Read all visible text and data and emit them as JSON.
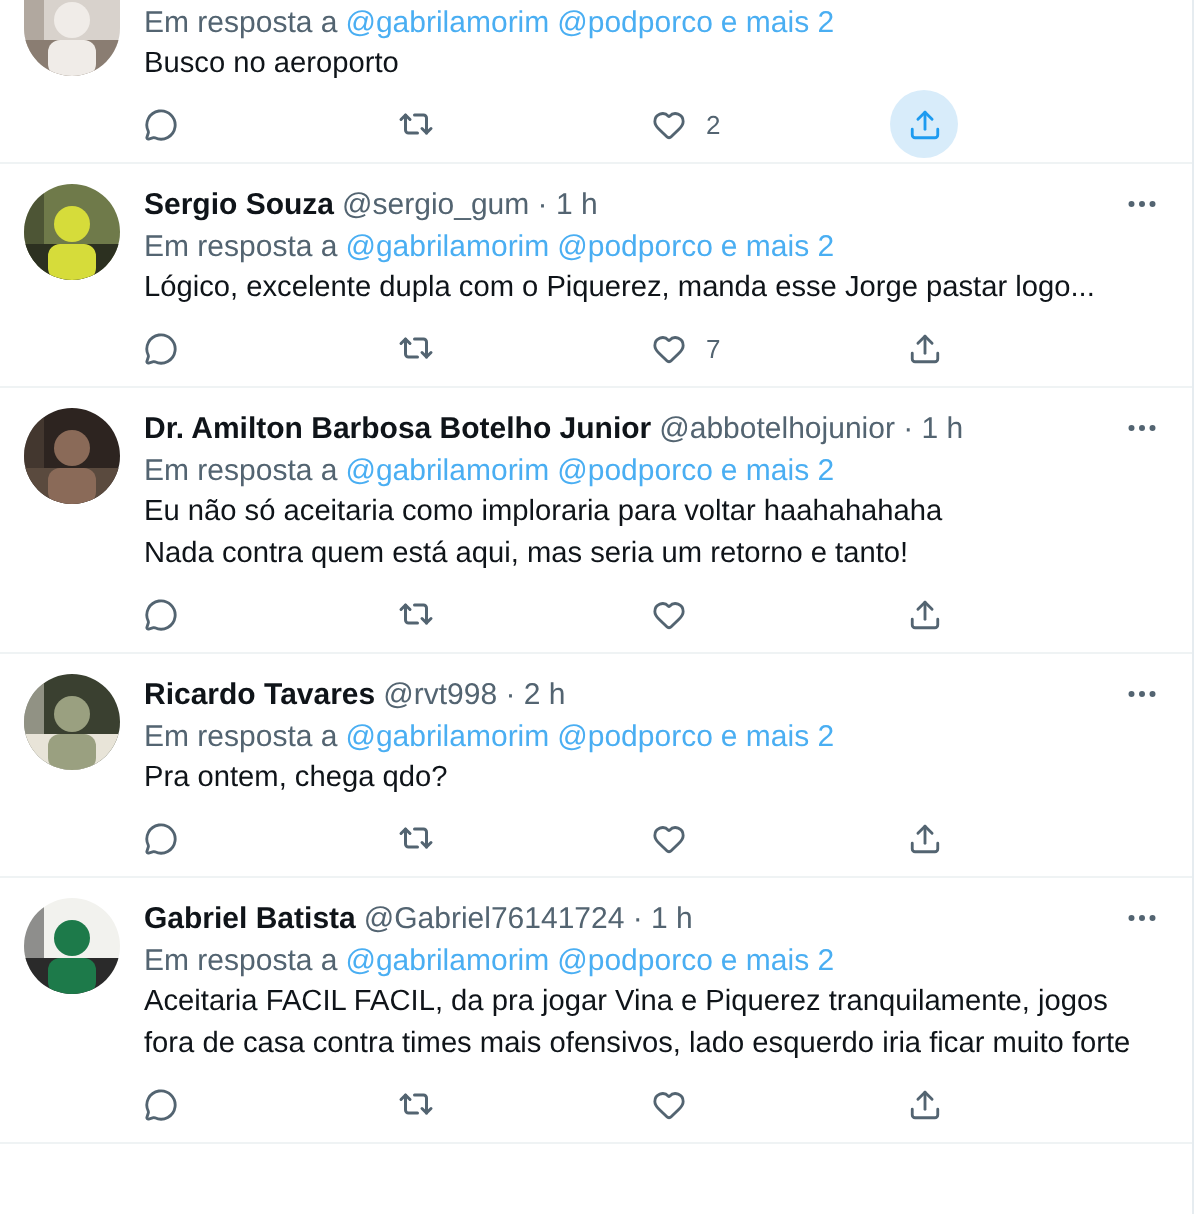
{
  "tweets": [
    {
      "clipped": true,
      "reply_to": {
        "prefix": "Em resposta a",
        "mentions": [
          "@gabrilamorim",
          "@podporco"
        ],
        "more": "e mais 2"
      },
      "lines": [
        "Busco no aeroporto"
      ],
      "likes": "2",
      "share_highlighted": true
    },
    {
      "clipped": false,
      "name": "Sergio Souza",
      "meta": "@sergio_gum · 1 h",
      "reply_to": {
        "prefix": "Em resposta a",
        "mentions": [
          "@gabrilamorim",
          "@podporco"
        ],
        "more": "e mais 2"
      },
      "lines": [
        "Lógico, excelente dupla com o Piquerez, manda esse Jorge pastar logo..."
      ],
      "likes": "7",
      "share_highlighted": false
    },
    {
      "clipped": false,
      "name": "Dr. Amilton Barbosa Botelho Junior",
      "meta": "@abbotelhojunior · 1 h",
      "reply_to": {
        "prefix": "Em resposta a",
        "mentions": [
          "@gabrilamorim",
          "@podporco"
        ],
        "more": "e mais 2"
      },
      "lines": [
        "Eu não só aceitaria como imploraria para voltar haahahahaha",
        "Nada contra quem está aqui, mas seria um retorno e tanto!"
      ],
      "share_highlighted": false
    },
    {
      "clipped": false,
      "name": "Ricardo Tavares",
      "meta": "@rvt998 · 2 h",
      "reply_to": {
        "prefix": "Em resposta a",
        "mentions": [
          "@gabrilamorim",
          "@podporco"
        ],
        "more": "e mais 2"
      },
      "lines": [
        "Pra ontem, chega qdo?"
      ],
      "share_highlighted": false
    },
    {
      "clipped": false,
      "name": "Gabriel Batista",
      "meta": "@Gabriel76141724 · 1 h",
      "reply_to": {
        "prefix": "Em resposta a",
        "mentions": [
          "@gabrilamorim",
          "@podporco"
        ],
        "more": "e mais 2"
      },
      "lines": [
        "Aceitaria FACIL FACIL, da pra jogar Vina e Piquerez tranquilamente, jogos fora de casa contra times mais ofensivos, lado esquerdo iria ficar muito forte"
      ],
      "share_highlighted": false
    }
  ]
}
